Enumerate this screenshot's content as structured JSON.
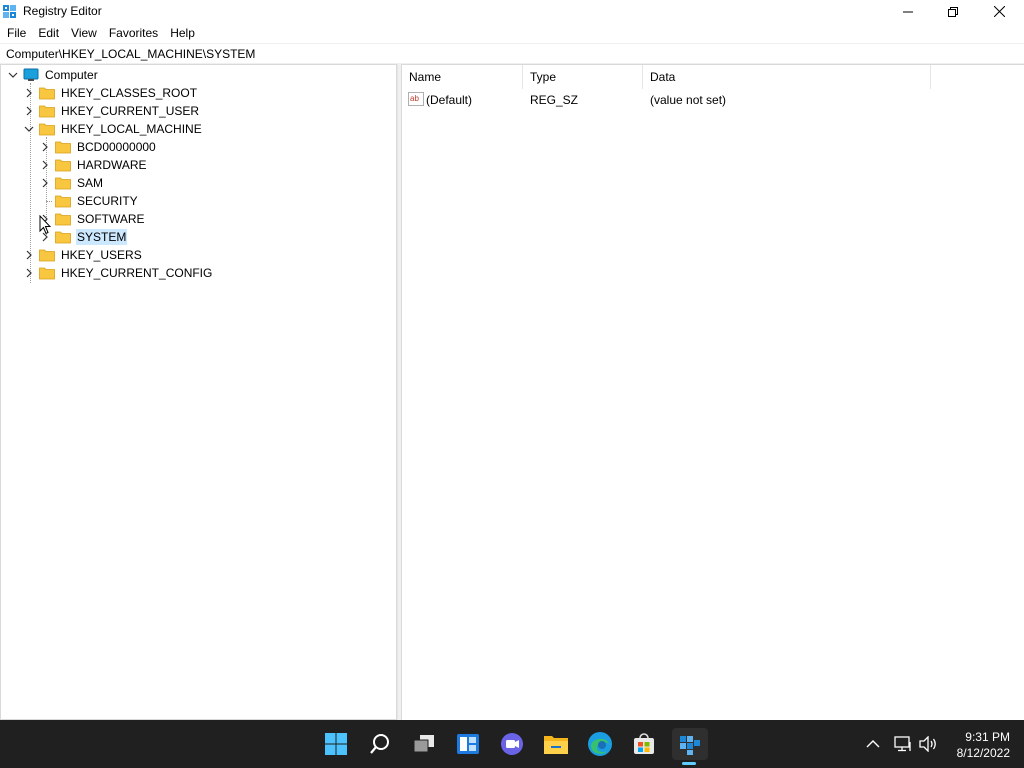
{
  "window": {
    "title": "Registry Editor"
  },
  "menu": [
    "File",
    "Edit",
    "View",
    "Favorites",
    "Help"
  ],
  "address": {
    "value": "Computer\\HKEY_LOCAL_MACHINE\\SYSTEM"
  },
  "tree": {
    "root": "Computer",
    "items": [
      {
        "label": "HKEY_CLASSES_ROOT",
        "expanded": false
      },
      {
        "label": "HKEY_CURRENT_USER",
        "expanded": false
      },
      {
        "label": "HKEY_LOCAL_MACHINE",
        "expanded": true
      },
      {
        "label": "BCD00000000",
        "expanded": false
      },
      {
        "label": "HARDWARE",
        "expanded": false
      },
      {
        "label": "SAM",
        "expanded": false
      },
      {
        "label": "SECURITY",
        "expanded": false
      },
      {
        "label": "SOFTWARE",
        "expanded": false
      },
      {
        "label": "SYSTEM",
        "expanded": false,
        "selected": true
      },
      {
        "label": "HKEY_USERS",
        "expanded": false
      },
      {
        "label": "HKEY_CURRENT_CONFIG",
        "expanded": false
      }
    ]
  },
  "values": {
    "columns": [
      "Name",
      "Type",
      "Data"
    ],
    "rows": [
      {
        "name": "(Default)",
        "type": "REG_SZ",
        "data": "(value not set)",
        "icon": "string-value-icon"
      }
    ]
  },
  "taskbar": {
    "apps": [
      "start-icon",
      "search-icon",
      "task-view-icon",
      "widgets-icon",
      "chat-icon",
      "file-explorer-icon",
      "edge-icon",
      "store-icon",
      "registry-editor-icon"
    ],
    "time": "9:31 PM",
    "date": "8/12/2022"
  },
  "colors": {
    "selection": "#cce8ff",
    "taskbar": "#202020",
    "accent": "#60cdff",
    "folder": "#f8c63f"
  }
}
